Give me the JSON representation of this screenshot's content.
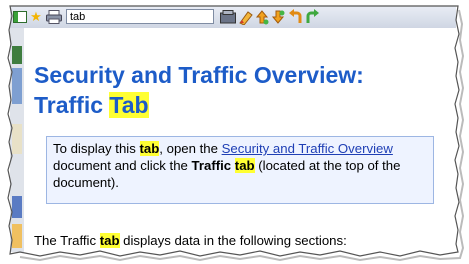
{
  "toolbar": {
    "search_value": "tab",
    "icons": [
      "show-navigation-icon",
      "favorites-star-icon",
      "print-icon",
      "search-go-icon",
      "highlight-pen-icon",
      "previous-hit-icon",
      "next-hit-icon",
      "back-icon",
      "forward-icon"
    ]
  },
  "document": {
    "title_line1": "Security and Traffic Overview:",
    "title_line2_prefix": "Traffic ",
    "title_line2_highlight": "Tab",
    "note": {
      "text1": "To display this ",
      "hl1": "tab",
      "text2": ", open the ",
      "link": "Security and Traffic Overview",
      "text3": " document and click the ",
      "bold1": "Traffic",
      "text4": " ",
      "hl2": "tab",
      "text5": " (located at the top of the document)."
    },
    "para": {
      "text1": "The Traffic ",
      "hl": "tab",
      "text2": " displays data in the following sections:"
    }
  },
  "colors": {
    "title": "#1d5cc8",
    "highlight": "#ffff33",
    "note_bg": "#eef3ff",
    "note_border": "#9db6e3",
    "link": "#1f3fb5"
  }
}
